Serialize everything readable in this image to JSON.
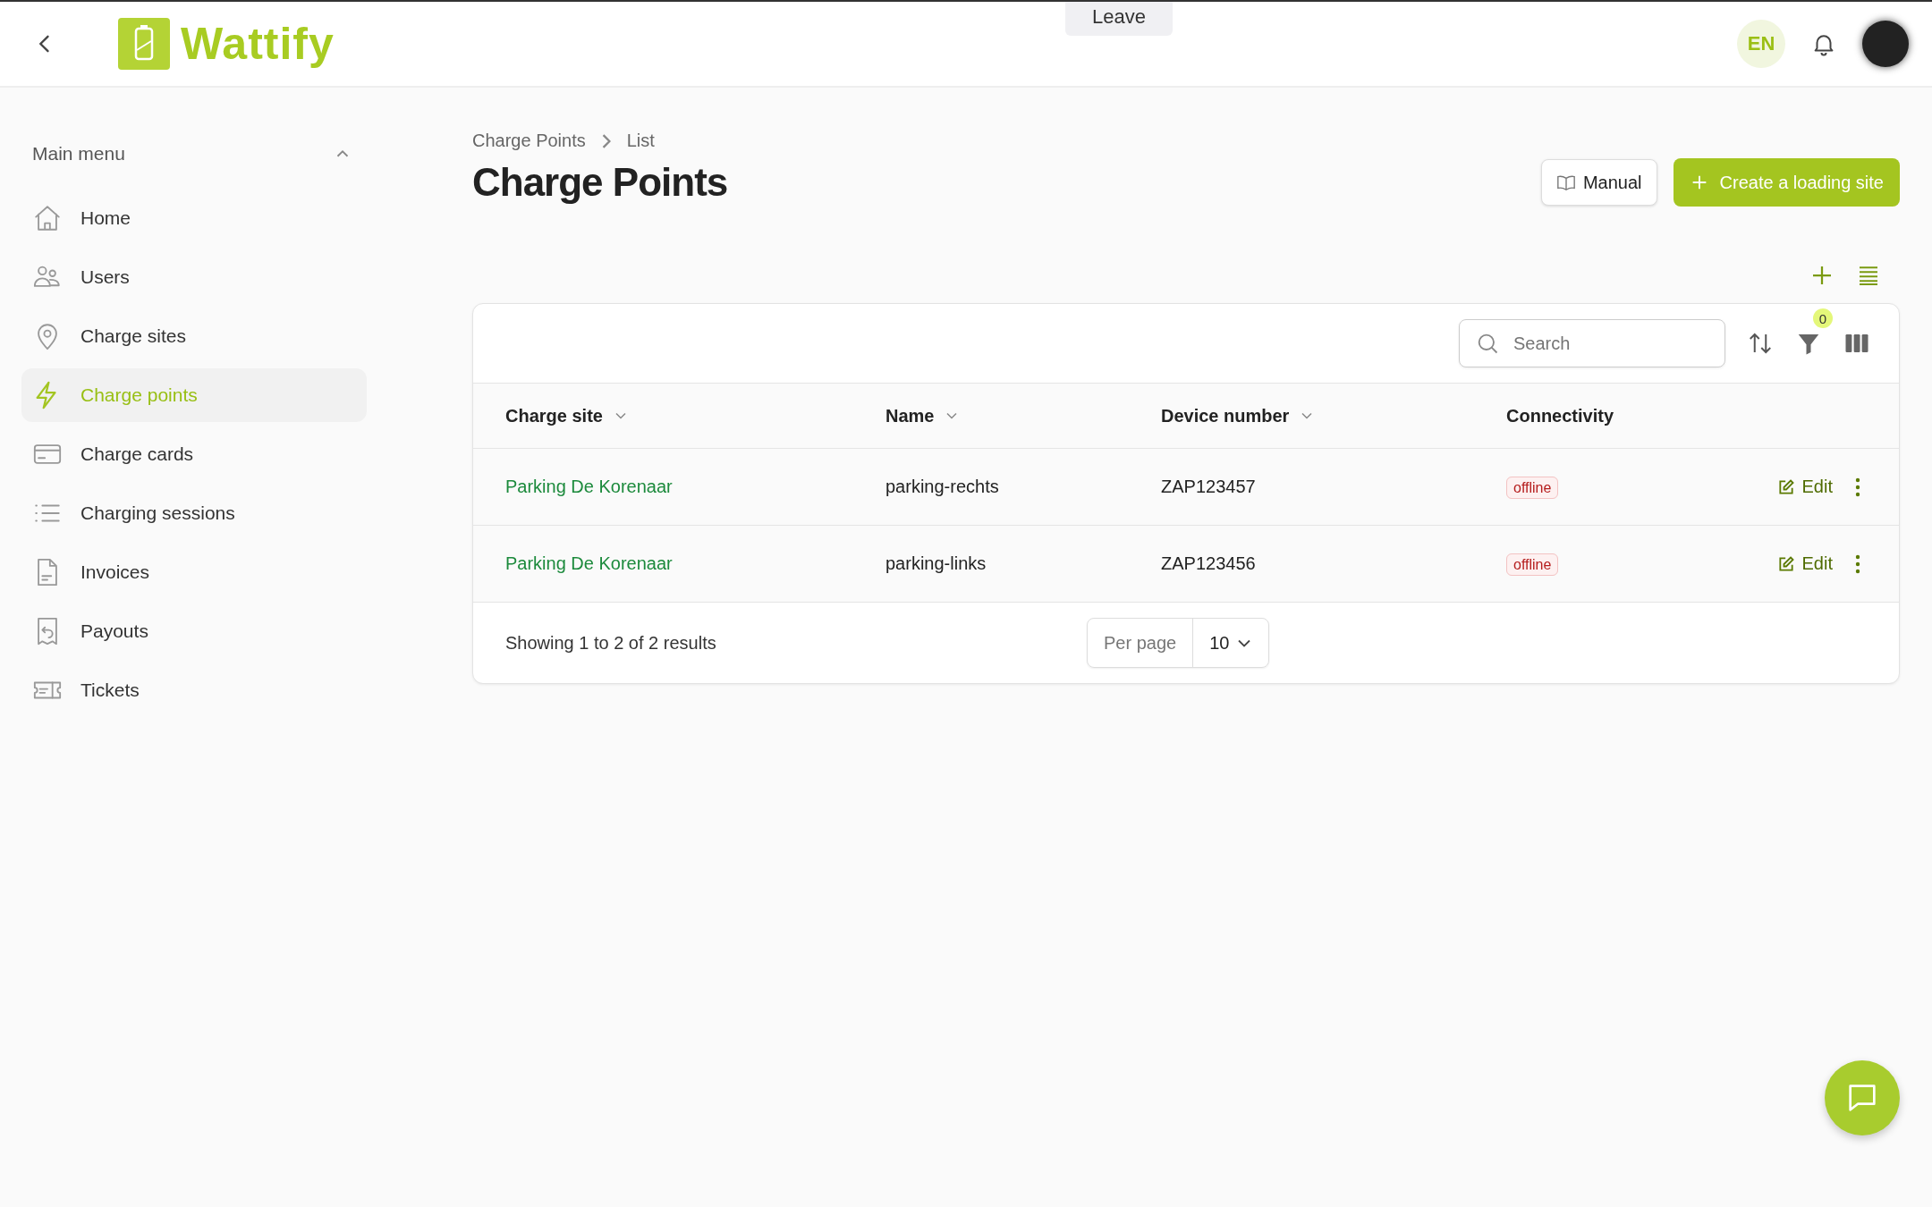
{
  "call_bar": {
    "button": "Leave"
  },
  "header": {
    "logo": "Wattify",
    "language": "EN"
  },
  "sidebar": {
    "title": "Main menu",
    "expanded": true,
    "items": [
      {
        "label": "Home",
        "selected": false
      },
      {
        "label": "Users",
        "selected": false
      },
      {
        "label": "Charge sites",
        "selected": false
      },
      {
        "label": "Charge points",
        "selected": true
      },
      {
        "label": "Charge cards",
        "selected": false
      },
      {
        "label": "Charging sessions",
        "selected": false
      },
      {
        "label": "Invoices",
        "selected": false
      },
      {
        "label": "Payouts",
        "selected": false
      },
      {
        "label": "Tickets",
        "selected": false
      }
    ]
  },
  "breadcrumb": [
    "Charge Points",
    "List"
  ],
  "title": "Charge Points",
  "actions": {
    "manual": "Manual",
    "create": "Create a loading site"
  },
  "table": {
    "search": {
      "placeholder": "Search"
    },
    "filter_count": "0",
    "columns": [
      {
        "label": "Charge site",
        "sortable": true
      },
      {
        "label": "Name",
        "sortable": true
      },
      {
        "label": "Device number",
        "sortable": true
      },
      {
        "label": "Connectivity",
        "sortable": false
      }
    ],
    "rows": [
      {
        "charge_site": "Parking De Korenaar",
        "name": "parking-rechts",
        "device_number": "ZAP123457",
        "connectivity": "offline",
        "edit": "Edit"
      },
      {
        "charge_site": "Parking De Korenaar",
        "name": "parking-links",
        "device_number": "ZAP123456",
        "connectivity": "offline",
        "edit": "Edit"
      }
    ],
    "footer": {
      "summary": "Showing 1 to 2 of 2 results",
      "per_page_label": "Per page",
      "per_page": "10"
    }
  }
}
